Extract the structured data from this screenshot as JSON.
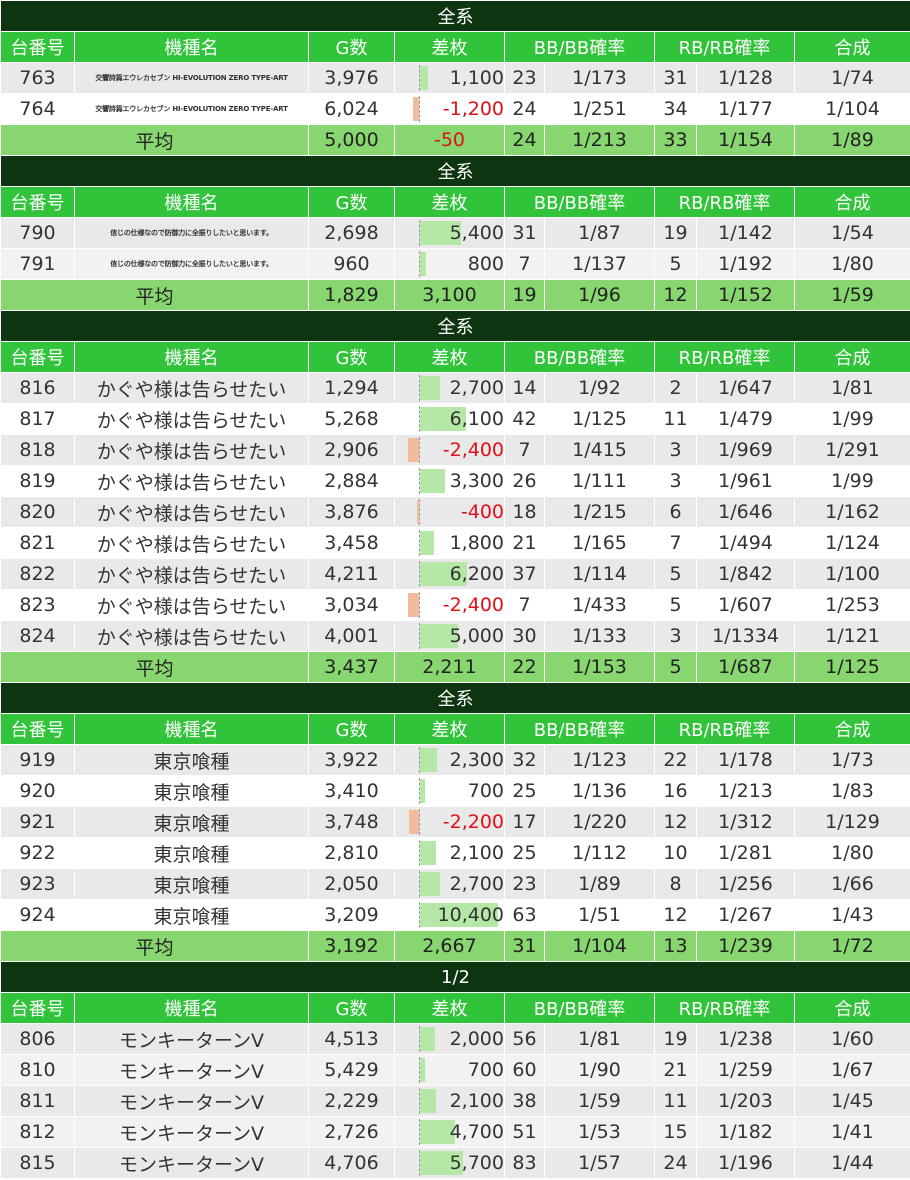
{
  "columns": [
    "台番号",
    "機種名",
    "G数",
    "差枚",
    "BB/BB確率",
    "RB/RB確率",
    "合成"
  ],
  "avg_label": "平均",
  "sections": [
    {
      "title": "全系",
      "rows": [
        {
          "no": "763",
          "name": "交響詩篇エウレカセブン HI-EVOLUTION ZERO TYPE-ART",
          "tiny": true,
          "g": "3,976",
          "diff": "1,100",
          "diff_value": 1100,
          "bb": "23",
          "bb_rate": "1/173",
          "rb": "31",
          "rb_rate": "1/128",
          "total": "1/74"
        },
        {
          "no": "764",
          "name": "交響詩篇エウレカセブン HI-EVOLUTION ZERO TYPE-ART",
          "tiny": true,
          "g": "6,024",
          "diff": "-1,200",
          "diff_value": -1200,
          "bb": "24",
          "bb_rate": "1/251",
          "rb": "34",
          "rb_rate": "1/177",
          "total": "1/104"
        }
      ],
      "avg": {
        "g": "5,000",
        "diff": "-50",
        "diff_value": -50,
        "bb": "24",
        "bb_rate": "1/213",
        "rb": "33",
        "rb_rate": "1/154",
        "total": "1/89"
      }
    },
    {
      "title": "全系",
      "rows": [
        {
          "no": "790",
          "name": "信じの仕様なので防御力に全振りしたいと思います。",
          "tiny": true,
          "g": "2,698",
          "diff": "5,400",
          "diff_value": 5400,
          "bb": "31",
          "bb_rate": "1/87",
          "rb": "19",
          "rb_rate": "1/142",
          "total": "1/54"
        },
        {
          "no": "791",
          "name": "信じの仕様なので防御力に全振りしたいと思います。",
          "tiny": true,
          "g": "960",
          "diff": "800",
          "diff_value": 800,
          "bb": "7",
          "bb_rate": "1/137",
          "rb": "5",
          "rb_rate": "1/192",
          "total": "1/80"
        }
      ],
      "avg": {
        "g": "1,829",
        "diff": "3,100",
        "diff_value": 3100,
        "bb": "19",
        "bb_rate": "1/96",
        "rb": "12",
        "rb_rate": "1/152",
        "total": "1/59"
      }
    },
    {
      "title": "全系",
      "rows": [
        {
          "no": "816",
          "name": "かぐや様は告らせたい",
          "tiny": false,
          "g": "1,294",
          "diff": "2,700",
          "diff_value": 2700,
          "bb": "14",
          "bb_rate": "1/92",
          "rb": "2",
          "rb_rate": "1/647",
          "total": "1/81"
        },
        {
          "no": "817",
          "name": "かぐや様は告らせたい",
          "tiny": false,
          "g": "5,268",
          "diff": "6,100",
          "diff_value": 6100,
          "bb": "42",
          "bb_rate": "1/125",
          "rb": "11",
          "rb_rate": "1/479",
          "total": "1/99"
        },
        {
          "no": "818",
          "name": "かぐや様は告らせたい",
          "tiny": false,
          "g": "2,906",
          "diff": "-2,400",
          "diff_value": -2400,
          "bb": "7",
          "bb_rate": "1/415",
          "rb": "3",
          "rb_rate": "1/969",
          "total": "1/291"
        },
        {
          "no": "819",
          "name": "かぐや様は告らせたい",
          "tiny": false,
          "g": "2,884",
          "diff": "3,300",
          "diff_value": 3300,
          "bb": "26",
          "bb_rate": "1/111",
          "rb": "3",
          "rb_rate": "1/961",
          "total": "1/99"
        },
        {
          "no": "820",
          "name": "かぐや様は告らせたい",
          "tiny": false,
          "g": "3,876",
          "diff": "-400",
          "diff_value": -400,
          "bb": "18",
          "bb_rate": "1/215",
          "rb": "6",
          "rb_rate": "1/646",
          "total": "1/162"
        },
        {
          "no": "821",
          "name": "かぐや様は告らせたい",
          "tiny": false,
          "g": "3,458",
          "diff": "1,800",
          "diff_value": 1800,
          "bb": "21",
          "bb_rate": "1/165",
          "rb": "7",
          "rb_rate": "1/494",
          "total": "1/124"
        },
        {
          "no": "822",
          "name": "かぐや様は告らせたい",
          "tiny": false,
          "g": "4,211",
          "diff": "6,200",
          "diff_value": 6200,
          "bb": "37",
          "bb_rate": "1/114",
          "rb": "5",
          "rb_rate": "1/842",
          "total": "1/100"
        },
        {
          "no": "823",
          "name": "かぐや様は告らせたい",
          "tiny": false,
          "g": "3,034",
          "diff": "-2,400",
          "diff_value": -2400,
          "bb": "7",
          "bb_rate": "1/433",
          "rb": "5",
          "rb_rate": "1/607",
          "total": "1/253"
        },
        {
          "no": "824",
          "name": "かぐや様は告らせたい",
          "tiny": false,
          "g": "4,001",
          "diff": "5,000",
          "diff_value": 5000,
          "bb": "30",
          "bb_rate": "1/133",
          "rb": "3",
          "rb_rate": "1/1334",
          "total": "1/121"
        }
      ],
      "avg": {
        "g": "3,437",
        "diff": "2,211",
        "diff_value": 2211,
        "bb": "22",
        "bb_rate": "1/153",
        "rb": "5",
        "rb_rate": "1/687",
        "total": "1/125"
      }
    },
    {
      "title": "全系",
      "rows": [
        {
          "no": "919",
          "name": "東京喰種",
          "tiny": false,
          "g": "3,922",
          "diff": "2,300",
          "diff_value": 2300,
          "bb": "32",
          "bb_rate": "1/123",
          "rb": "22",
          "rb_rate": "1/178",
          "total": "1/73"
        },
        {
          "no": "920",
          "name": "東京喰種",
          "tiny": false,
          "g": "3,410",
          "diff": "700",
          "diff_value": 700,
          "bb": "25",
          "bb_rate": "1/136",
          "rb": "16",
          "rb_rate": "1/213",
          "total": "1/83"
        },
        {
          "no": "921",
          "name": "東京喰種",
          "tiny": false,
          "g": "3,748",
          "diff": "-2,200",
          "diff_value": -2200,
          "bb": "17",
          "bb_rate": "1/220",
          "rb": "12",
          "rb_rate": "1/312",
          "total": "1/129"
        },
        {
          "no": "922",
          "name": "東京喰種",
          "tiny": false,
          "g": "2,810",
          "diff": "2,100",
          "diff_value": 2100,
          "bb": "25",
          "bb_rate": "1/112",
          "rb": "10",
          "rb_rate": "1/281",
          "total": "1/80"
        },
        {
          "no": "923",
          "name": "東京喰種",
          "tiny": false,
          "g": "2,050",
          "diff": "2,700",
          "diff_value": 2700,
          "bb": "23",
          "bb_rate": "1/89",
          "rb": "8",
          "rb_rate": "1/256",
          "total": "1/66"
        },
        {
          "no": "924",
          "name": "東京喰種",
          "tiny": false,
          "g": "3,209",
          "diff": "10,400",
          "diff_value": 10400,
          "bb": "63",
          "bb_rate": "1/51",
          "rb": "12",
          "rb_rate": "1/267",
          "total": "1/43"
        }
      ],
      "avg": {
        "g": "3,192",
        "diff": "2,667",
        "diff_value": 2667,
        "bb": "31",
        "bb_rate": "1/104",
        "rb": "13",
        "rb_rate": "1/239",
        "total": "1/72"
      }
    },
    {
      "title": "1/2",
      "rows": [
        {
          "no": "806",
          "name": "モンキーターンV",
          "tiny": false,
          "g": "4,513",
          "diff": "2,000",
          "diff_value": 2000,
          "bb": "56",
          "bb_rate": "1/81",
          "rb": "19",
          "rb_rate": "1/238",
          "total": "1/60"
        },
        {
          "no": "810",
          "name": "モンキーターンV",
          "tiny": false,
          "g": "5,429",
          "diff": "700",
          "diff_value": 700,
          "bb": "60",
          "bb_rate": "1/90",
          "rb": "21",
          "rb_rate": "1/259",
          "total": "1/67"
        },
        {
          "no": "811",
          "name": "モンキーターンV",
          "tiny": false,
          "g": "2,229",
          "diff": "2,100",
          "diff_value": 2100,
          "bb": "38",
          "bb_rate": "1/59",
          "rb": "11",
          "rb_rate": "1/203",
          "total": "1/45"
        },
        {
          "no": "812",
          "name": "モンキーターンV",
          "tiny": false,
          "g": "2,726",
          "diff": "4,700",
          "diff_value": 4700,
          "bb": "51",
          "bb_rate": "1/53",
          "rb": "15",
          "rb_rate": "1/182",
          "total": "1/41"
        },
        {
          "no": "815",
          "name": "モンキーターンV",
          "tiny": false,
          "g": "4,706",
          "diff": "5,700",
          "diff_value": 5700,
          "bb": "83",
          "bb_rate": "1/57",
          "rb": "24",
          "rb_rate": "1/196",
          "total": "1/44"
        }
      ]
    }
  ],
  "colors": {
    "title_bg": "#0d3512",
    "header_bg": "#31c43a",
    "avg_bg": "#88d66f",
    "positive_bar": "#b5e8a6",
    "negative_bar": "#f4bb9b",
    "negative_text": "#e0101a"
  }
}
